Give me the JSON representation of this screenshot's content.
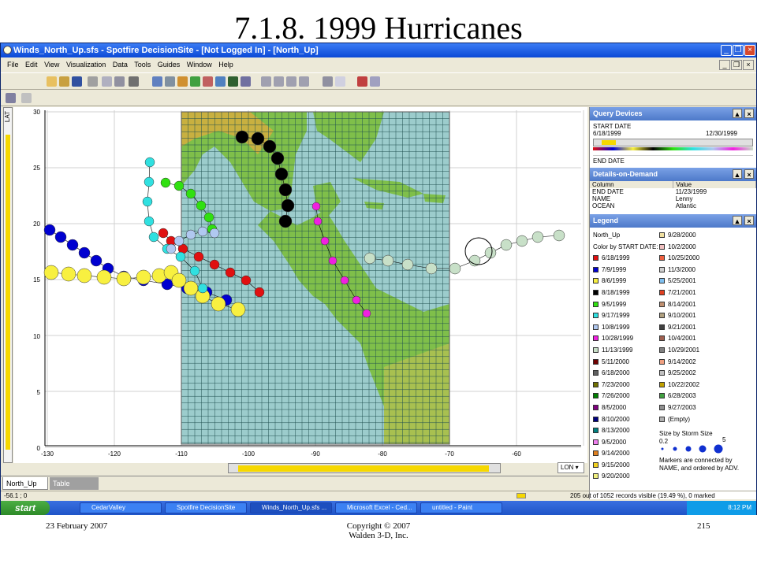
{
  "slide": {
    "title": "7.1.8. 1999 Hurricanes",
    "footer_left": "23 February 2007",
    "footer_center_1": "Copyright © 2007",
    "footer_center_2": "Walden 3-D, Inc.",
    "footer_right": "215"
  },
  "window": {
    "title": "Winds_North_Up.sfs - Spotfire DecisionSite - [Not Logged In] - [North_Up]",
    "menu": [
      "File",
      "Edit",
      "View",
      "Visualization",
      "Data",
      "Tools",
      "Guides",
      "Window",
      "Help"
    ]
  },
  "plot": {
    "y_axis_label": "LAT",
    "x_axis_selector": "LON",
    "x_ticks": [
      "-130",
      "-120",
      "-110",
      "-100",
      "-90",
      "-80",
      "-70",
      "-60"
    ],
    "y_ticks": [
      "30",
      "25",
      "20",
      "15",
      "10",
      "5",
      "0"
    ]
  },
  "query_devices": {
    "title": "Query Devices",
    "start_label": "START DATE",
    "start_min": "6/18/1999",
    "start_max": "12/30/1999",
    "end_label": "END DATE"
  },
  "details": {
    "title": "Details-on-Demand",
    "col_header": "Column",
    "val_header": "Value",
    "rows": [
      {
        "col": "END DATE",
        "val": "11/23/1999"
      },
      {
        "col": "NAME",
        "val": "Lenny"
      },
      {
        "col": "OCEAN",
        "val": "Atlantic"
      }
    ]
  },
  "legend": {
    "title": "Legend",
    "view_name": "North_Up",
    "color_by": "Color by START DATE:",
    "col1": [
      {
        "label": "6/18/1999",
        "color": "#e01010"
      },
      {
        "label": "7/9/1999",
        "color": "#0000d0"
      },
      {
        "label": "8/6/1999",
        "color": "#f8f040"
      },
      {
        "label": "8/18/1999",
        "color": "#000000"
      },
      {
        "label": "9/5/1999",
        "color": "#30e010"
      },
      {
        "label": "9/17/1999",
        "color": "#30e0e0"
      },
      {
        "label": "10/8/1999",
        "color": "#b0c8f0"
      },
      {
        "label": "10/28/1999",
        "color": "#f020e0"
      },
      {
        "label": "11/13/1999",
        "color": "#c8e0c8"
      },
      {
        "label": "5/11/2000",
        "color": "#700000"
      },
      {
        "label": "6/18/2000",
        "color": "#606060"
      },
      {
        "label": "7/23/2000",
        "color": "#707000"
      },
      {
        "label": "7/26/2000",
        "color": "#008000"
      },
      {
        "label": "8/5/2000",
        "color": "#800080"
      },
      {
        "label": "8/10/2000",
        "color": "#000080"
      },
      {
        "label": "8/13/2000",
        "color": "#008080"
      },
      {
        "label": "9/5/2000",
        "color": "#f080f0"
      },
      {
        "label": "9/14/2000",
        "color": "#e08020"
      },
      {
        "label": "9/15/2000",
        "color": "#f0d020"
      },
      {
        "label": "9/20/2000",
        "color": "#f0f080"
      }
    ],
    "col2": [
      {
        "label": "9/28/2000",
        "color": "#f0e0a0"
      },
      {
        "label": "10/2/2000",
        "color": "#f0c0c0"
      },
      {
        "label": "10/25/2000",
        "color": "#f06040"
      },
      {
        "label": "11/3/2000",
        "color": "#d0d0d0"
      },
      {
        "label": "5/25/2001",
        "color": "#80c0f0"
      },
      {
        "label": "7/21/2001",
        "color": "#e04020"
      },
      {
        "label": "8/14/2001",
        "color": "#c09070"
      },
      {
        "label": "9/10/2001",
        "color": "#b0a080"
      },
      {
        "label": "9/21/2001",
        "color": "#404040"
      },
      {
        "label": "10/4/2001",
        "color": "#a06050"
      },
      {
        "label": "10/29/2001",
        "color": "#808080"
      },
      {
        "label": "9/14/2002",
        "color": "#f0a080"
      },
      {
        "label": "9/25/2002",
        "color": "#c0c0c0"
      },
      {
        "label": "10/22/2002",
        "color": "#c0a000"
      },
      {
        "label": "6/28/2003",
        "color": "#40a040"
      },
      {
        "label": "9/27/2003",
        "color": "#909090"
      },
      {
        "label": "(Empty)",
        "color": "#b0b0b0"
      }
    ],
    "size_by": "Size by Storm Size",
    "size_min": "0.2",
    "size_max": "5",
    "note": "Markers are connected by NAME, and ordered by ADV."
  },
  "tabs": [
    "North_Up",
    "Table"
  ],
  "status": {
    "left": "-56.1 ; 0",
    "right": "205 out of 1052 records visible (19.49 %), 0 marked"
  },
  "taskbar": {
    "start": "start",
    "tasks": [
      "CedarValley",
      "Spotfire DecisionSite",
      "Winds_North_Up.sfs ...",
      "Microsoft Excel - Ced...",
      "untitled - Paint"
    ],
    "clock": "8:12 PM"
  }
}
